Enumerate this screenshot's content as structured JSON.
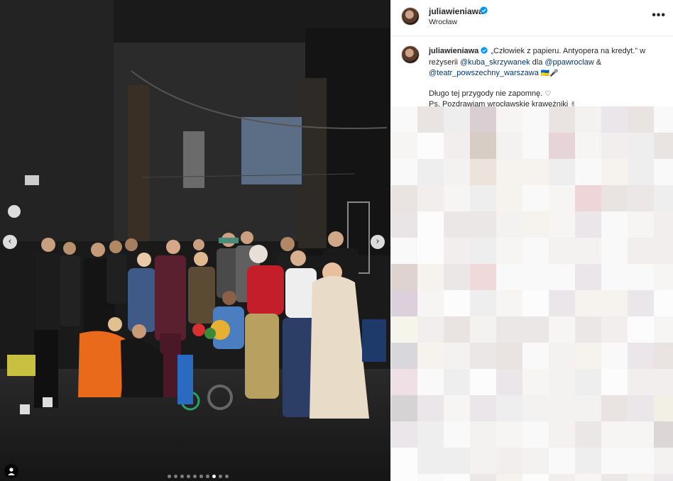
{
  "post": {
    "username": "juliawieniawa",
    "location": "Wrocław",
    "more_icon": "more-horizontal-icon",
    "verified_color": "#0095f6"
  },
  "caption": {
    "username": "juliawieniawa",
    "line1_a": " „Człowiek z papieru. Antyopera na kredyt.” w reżyserii ",
    "mention1": "@kuba_skrzywanek",
    "line1_b": " dla ",
    "mention2": "@ppawroclaw",
    "line1_c": " & ",
    "mention3": "@teatr_powszechny_warszawa",
    "emoji1": "🇺🇦🎤",
    "line2": "Długo tej przygody nie zapomnę. ",
    "heart": "♡",
    "line3": "Ps. Pozdrawiam wrocławskie krawężniki ",
    "emoji2": "✌"
  },
  "media": {
    "prev_icon": "chevron-left-icon",
    "next_icon": "chevron-right-icon",
    "prev_glyph": "‹",
    "next_glyph": "›",
    "dot_count": 10,
    "active_dot": 7,
    "tag_icon": "user-tag-icon"
  },
  "colors": {
    "accent": "#0095f6",
    "mention": "#00376b"
  }
}
